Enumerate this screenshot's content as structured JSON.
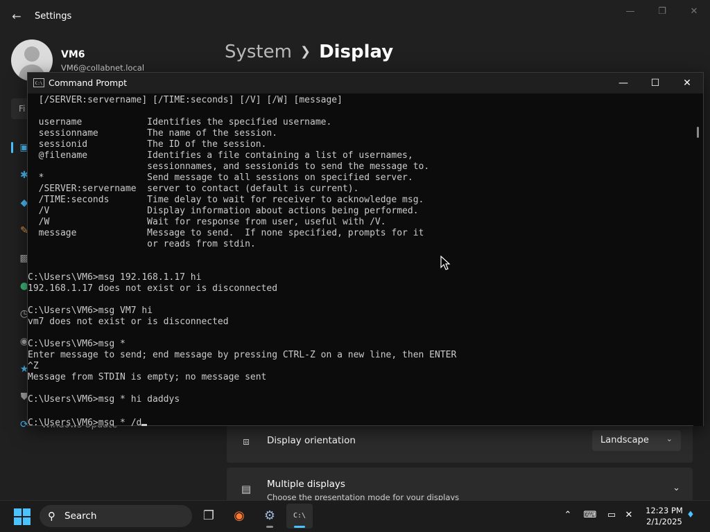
{
  "settings": {
    "title": "Settings",
    "user": {
      "name": "VM6",
      "email": "VM6@collabnet.local"
    },
    "breadcrumb": {
      "parent": "System",
      "current": "Display"
    },
    "find_placeholder": "Fi",
    "sidebar_visible_label": "Windows Update",
    "cards": {
      "orientation": {
        "label": "Display orientation",
        "value": "Landscape"
      },
      "multiple": {
        "label": "Multiple displays",
        "sub": "Choose the presentation mode for your displays"
      }
    }
  },
  "cmd": {
    "title": "Command Prompt",
    "icon_text": "C:\\",
    "lines": [
      "  [/SERVER:servername] [/TIME:seconds] [/V] [/W] [message]",
      "",
      "  username            Identifies the specified username.",
      "  sessionname         The name of the session.",
      "  sessionid           The ID of the session.",
      "  @filename           Identifies a file containing a list of usernames,",
      "                      sessionnames, and sessionids to send the message to.",
      "  *                   Send message to all sessions on specified server.",
      "  /SERVER:servername  server to contact (default is current).",
      "  /TIME:seconds       Time delay to wait for receiver to acknowledge msg.",
      "  /V                  Display information about actions being performed.",
      "  /W                  Wait for response from user, useful with /V.",
      "  message             Message to send.  If none specified, prompts for it",
      "                      or reads from stdin.",
      "",
      "",
      "C:\\Users\\VM6>msg 192.168.1.17 hi",
      "192.168.1.17 does not exist or is disconnected",
      "",
      "C:\\Users\\VM6>msg VM7 hi",
      "vm7 does not exist or is disconnected",
      "",
      "C:\\Users\\VM6>msg *",
      "Enter message to send; end message by pressing CTRL-Z on a new line, then ENTER",
      "^Z",
      "Message from STDIN is empty; no message sent",
      "",
      "C:\\Users\\VM6>msg * hi daddys",
      ""
    ],
    "current_input": "C:\\Users\\VM6>msg * /d"
  },
  "taskbar": {
    "search_label": "Search",
    "time": "12:23 PM",
    "date": "2/1/2025"
  },
  "colors": {
    "accent": "#4cc2ff",
    "terminal_bg": "#0c0c0c",
    "terminal_fg": "#cccccc"
  },
  "icons": [
    "back-arrow-icon",
    "minimize-icon",
    "maximize-icon",
    "close-icon",
    "search-icon",
    "chevron-down-icon",
    "bell-icon",
    "wifi-icon",
    "keyboard-icon",
    "chevron-up-icon"
  ]
}
